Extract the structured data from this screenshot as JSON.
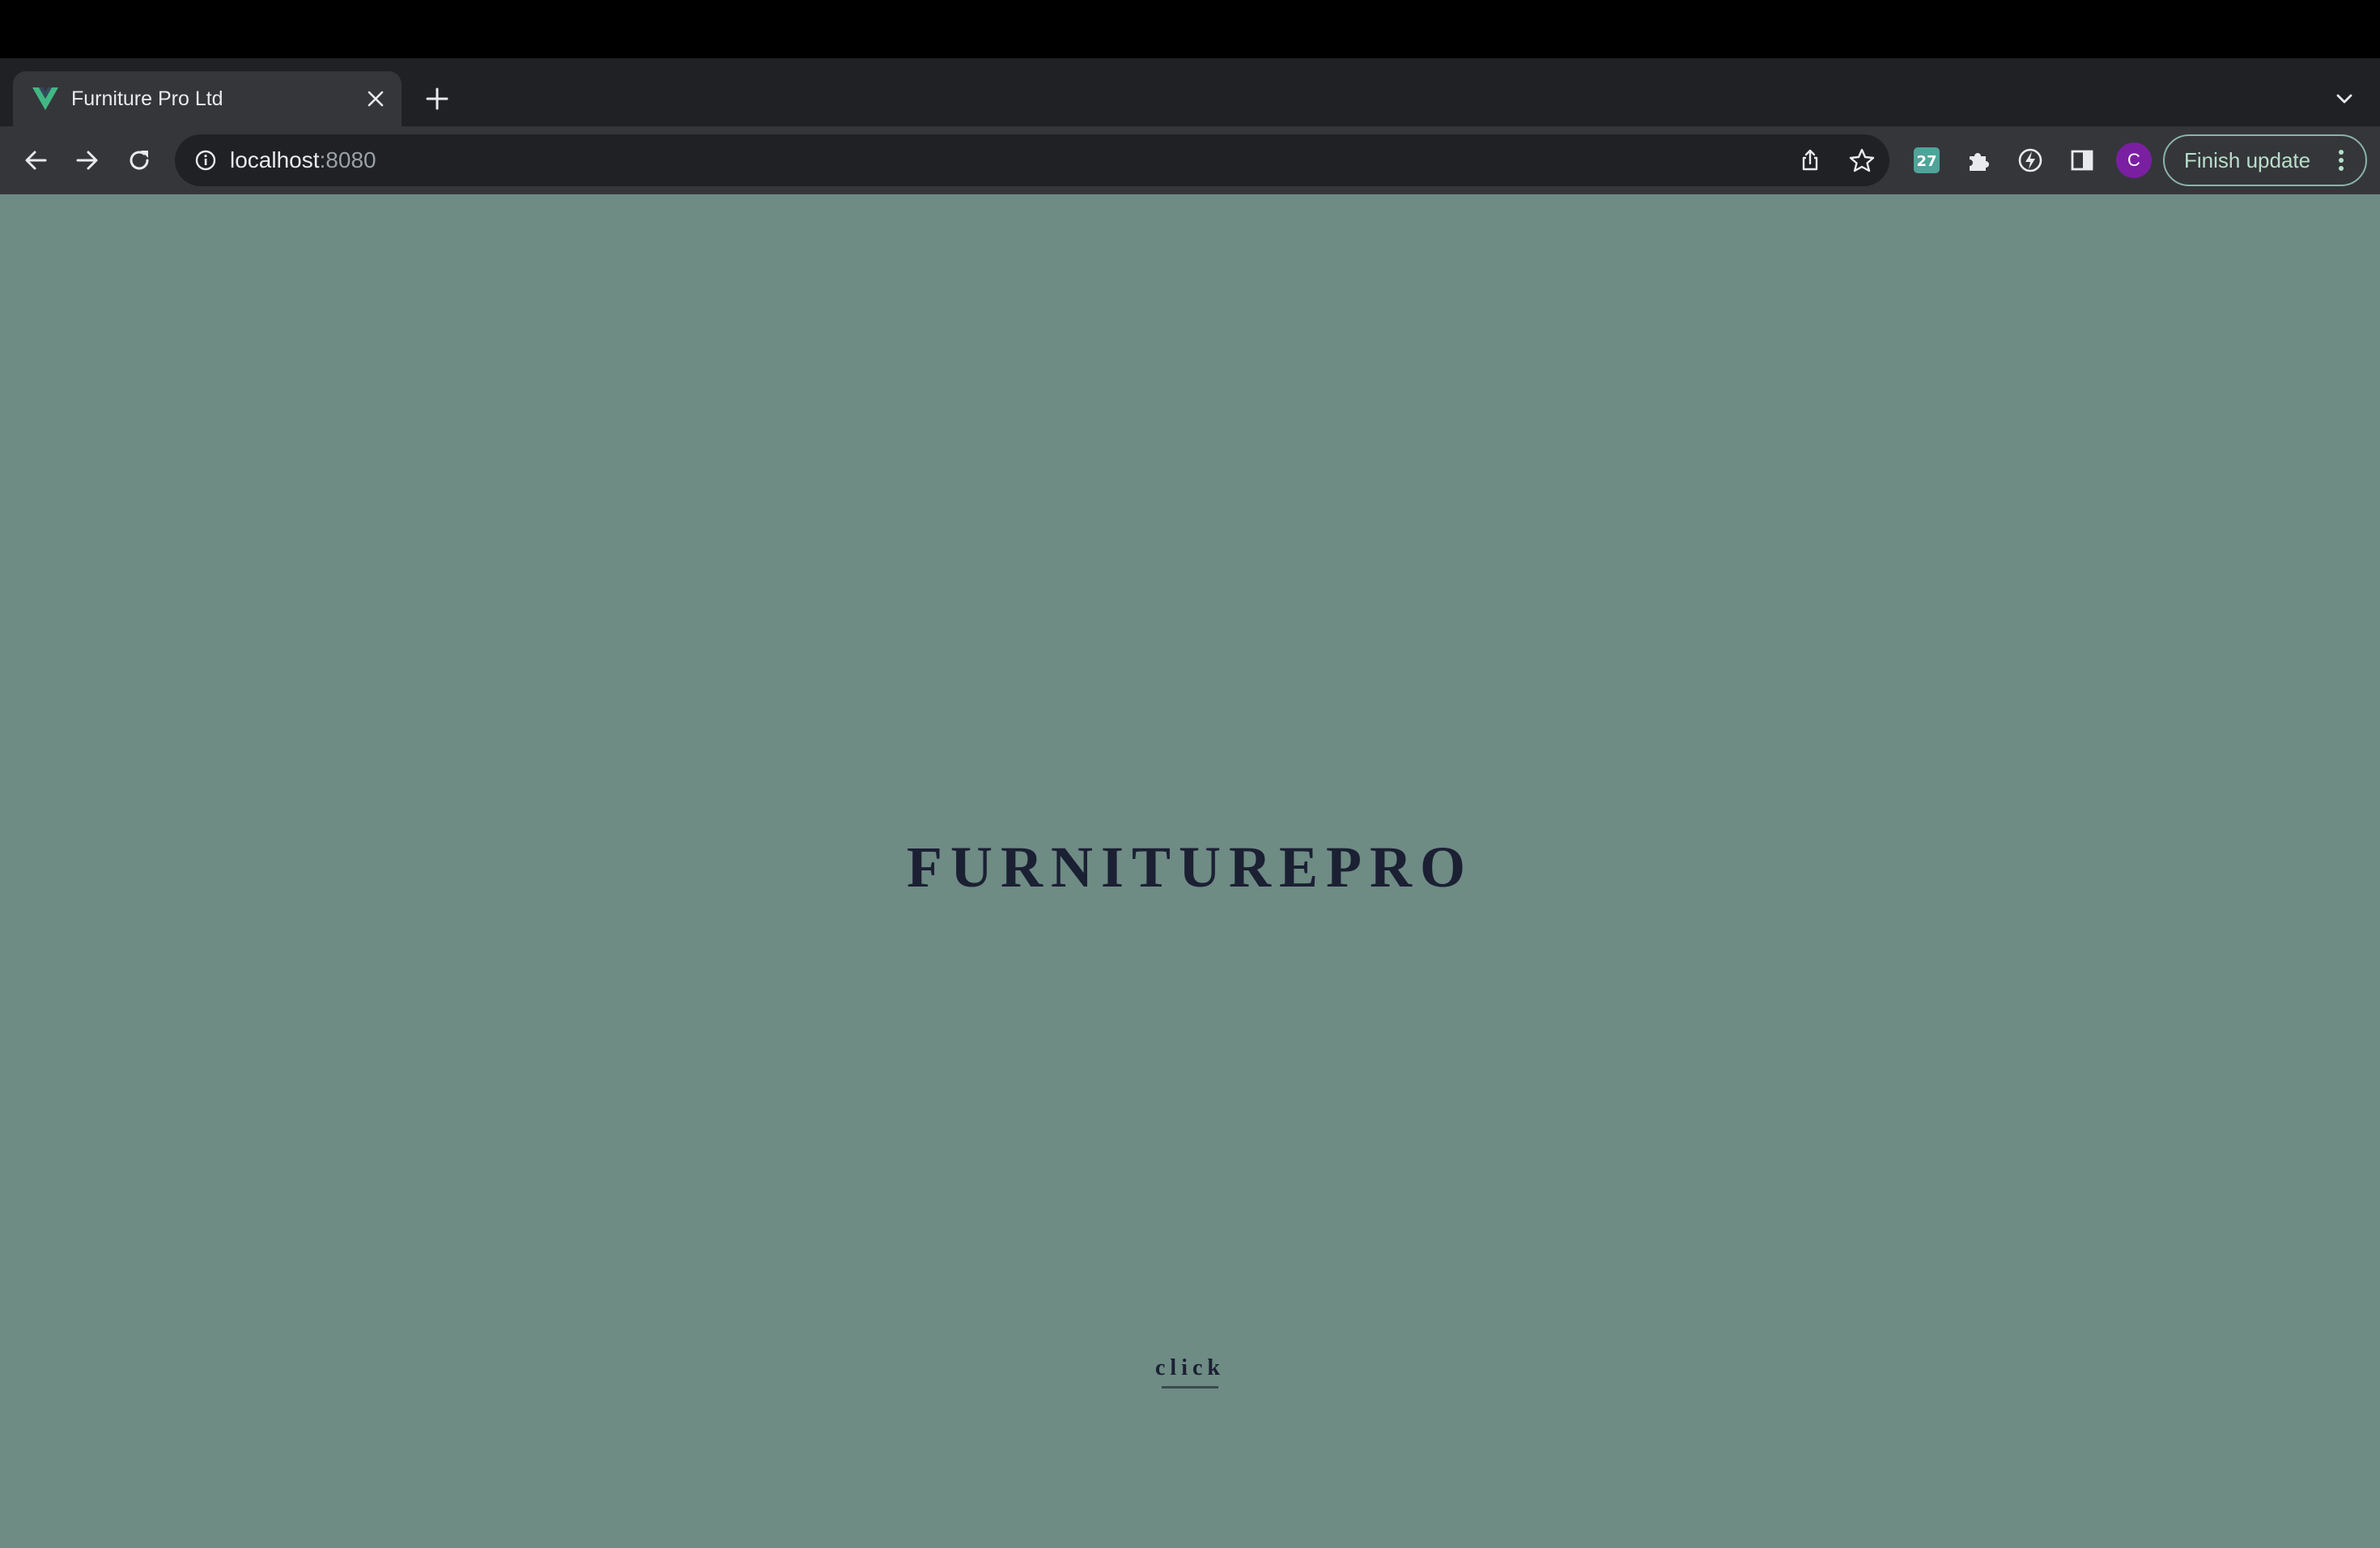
{
  "browser": {
    "tab": {
      "title": "Furniture Pro Ltd",
      "favicon": "vue-logo-icon"
    },
    "address_bar": {
      "host": "localhost",
      "port": ":8080"
    },
    "profile_initial": "C",
    "finish_update_label": "Finish update",
    "extension_badge": "27",
    "colors": {
      "chrome_dark": "#202124",
      "chrome_toolbar": "#35363a",
      "avatar": "#7b1fa2",
      "update_green": "#b7dfc9"
    }
  },
  "page": {
    "brand_title": "FURNITUREPRO",
    "click_label": "click",
    "colors": {
      "background": "#6e8b84",
      "text": "#1b2033"
    }
  }
}
